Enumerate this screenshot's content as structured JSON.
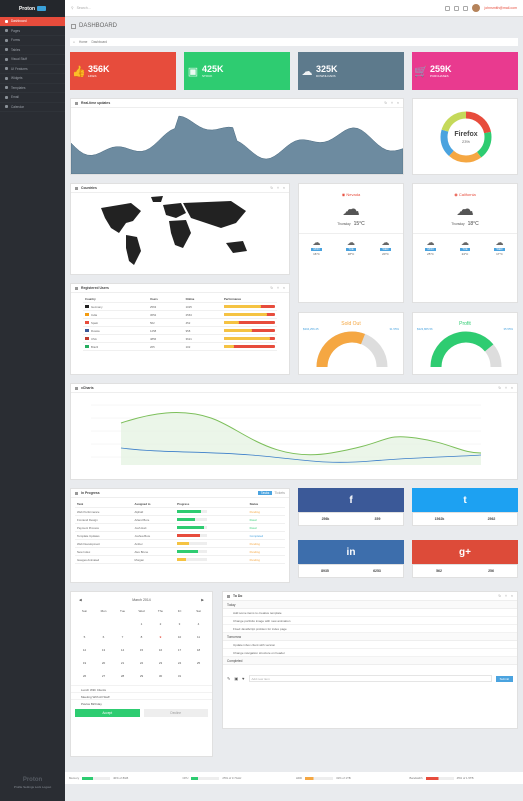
{
  "brand": {
    "name": "Proton"
  },
  "sidebar": {
    "items": [
      {
        "label": "Dashboard"
      },
      {
        "label": "Pages"
      },
      {
        "label": "Forms"
      },
      {
        "label": "Tables"
      },
      {
        "label": "Visual Stuff"
      },
      {
        "label": "UI Features"
      },
      {
        "label": "Widgets"
      },
      {
        "label": "Templates"
      },
      {
        "label": "Email"
      },
      {
        "label": "Calendar"
      }
    ],
    "footer_name": "Proton",
    "footer_links": "Profile  Settings  Lock  Logout"
  },
  "topbar": {
    "search_placeholder": "Search...",
    "user_email": "johnsmith@mail.com"
  },
  "page": {
    "title": "DASHBOARD"
  },
  "breadcrumb": {
    "home": "Home",
    "current": "Dashboard"
  },
  "stats": [
    {
      "value": "356K",
      "label": "LIKES",
      "color": "#e74c3c",
      "icon": "thumbs-up-icon"
    },
    {
      "value": "425K",
      "label": "STOCK",
      "color": "#2ecc71",
      "icon": "boxes-icon"
    },
    {
      "value": "325K",
      "label": "DOWNLOADS",
      "color": "#5d7a8c",
      "icon": "cloud-download-icon"
    },
    {
      "value": "259K",
      "label": "PURCHASES",
      "color": "#e93a8f",
      "icon": "cart-icon"
    }
  ],
  "realtime": {
    "title": "Real-time updates"
  },
  "browser": {
    "name": "Firefox",
    "percent": "23%"
  },
  "countries": {
    "title": "Countries"
  },
  "weather": [
    {
      "location": "Nevada",
      "label": "Thursday",
      "temp": "15°C",
      "days": [
        {
          "d": "MON",
          "t": "16°C"
        },
        {
          "d": "TUE",
          "t": "18°C"
        },
        {
          "d": "WED",
          "t": "20°C"
        }
      ]
    },
    {
      "location": "California",
      "label": "Thursday",
      "temp": "18°C",
      "days": [
        {
          "d": "MON",
          "t": "25°C"
        },
        {
          "d": "TUE",
          "t": "24°C"
        },
        {
          "d": "WED",
          "t": "17°C"
        }
      ]
    }
  ],
  "registered": {
    "title": "Registered Users",
    "headers": [
      "Country",
      "Users",
      "Online",
      "Performance"
    ],
    "rows": [
      {
        "country": "Germany",
        "users": "2563",
        "online": "1025"
      },
      {
        "country": "India",
        "users": "3652",
        "online": "2563"
      },
      {
        "country": "Spain",
        "users": "562",
        "online": "452"
      },
      {
        "country": "Russia",
        "users": "1258",
        "online": "958"
      },
      {
        "country": "USA",
        "users": "4856",
        "online": "3621"
      },
      {
        "country": "Brazil",
        "users": "265",
        "online": "102"
      }
    ],
    "performance": [
      0.72,
      0.85,
      0.3,
      0.55,
      0.9,
      0.2
    ]
  },
  "sold_out": {
    "title": "Sold Out",
    "left": "$304,256.25",
    "right": "31.55%",
    "level": 0.62
  },
  "profit": {
    "title": "Profit",
    "left": "$323,865.56",
    "right": "35.55%",
    "level": 0.78
  },
  "chart_section": {
    "title": "xCharts"
  },
  "in_progress": {
    "title": "In Progress",
    "tab_active": "Tasks",
    "tab_other": "Tickets",
    "headers": [
      "Task",
      "Assigned to",
      "Progress",
      "Status"
    ],
    "rows": [
      {
        "task": "Web Performance",
        "to": "Alpha0",
        "status": "Pending"
      },
      {
        "task": "Frontend Design",
        "to": "Arland Bore",
        "status": "Fixed"
      },
      {
        "task": "Payment Process",
        "to": "Josh Hart",
        "status": "Fixed"
      },
      {
        "task": "Template Updates",
        "to": "Joshua Bore",
        "status": "Completed"
      },
      {
        "task": "Web Development",
        "to": "Amber",
        "status": "Pending"
      },
      {
        "task": "New Index",
        "to": "Alex Brune",
        "status": "Pending"
      },
      {
        "task": "Gauges Animated",
        "to": "Morgan",
        "status": "Pending"
      }
    ],
    "progress": [
      0.8,
      0.6,
      0.9,
      0.75,
      0.4,
      0.7,
      0.3
    ],
    "progress_colors": [
      "#2ecc71",
      "#2ecc71",
      "#2ecc71",
      "#e74c3c",
      "#f5c342",
      "#2ecc71",
      "#f5c342"
    ]
  },
  "social": [
    {
      "network": "f",
      "left": "256k",
      "right": "359",
      "color": "#3b5998"
    },
    {
      "network": "t",
      "left": "1562k",
      "right": "2562",
      "color": "#1da1f2"
    },
    {
      "network": "in",
      "left": "8935",
      "right": "6253",
      "color": "#3d6eac"
    },
    {
      "network": "g+",
      "left": "562",
      "right": "256",
      "color": "#dd4b39"
    }
  ],
  "calendar": {
    "month": "March 2014",
    "weekdays": [
      "Sun",
      "Mon",
      "Tue",
      "Wed",
      "Thu",
      "Fri",
      "Sat"
    ],
    "today": "9",
    "events": [
      "Lunch With Clients",
      "Meeting With All Staff",
      "Pavlos Birthday"
    ],
    "accept": "Accept",
    "decline": "Decline"
  },
  "todo": {
    "title": "To Do",
    "sections": [
      {
        "name": "Today",
        "items": [
          "Add some items to creative template",
          "Change portfolio image with new animation",
          "Fixed JavaScript problem for index page"
        ]
      },
      {
        "name": "Tomorrow",
        "items": [
          "Update inbox client with version",
          "Change navigation structure on header"
        ]
      },
      {
        "name": "Completed",
        "items": []
      }
    ],
    "input_placeholder": "Add new item",
    "submit": "Submit"
  },
  "bottom_stats": [
    {
      "label": "Memory",
      "value": "40% of 8GB",
      "color": "#2ecc71",
      "level": 0.4
    },
    {
      "label": "CPU",
      "value": "25% of 3.7GHz",
      "color": "#2ecc71",
      "level": 0.25
    },
    {
      "label": "HDD",
      "value": "31% of 1TB",
      "color": "#f5a742",
      "level": 0.31
    },
    {
      "label": "Bandwidth",
      "value": "45% of 1.5TB",
      "color": "#e74c3c",
      "level": 0.45
    }
  ]
}
